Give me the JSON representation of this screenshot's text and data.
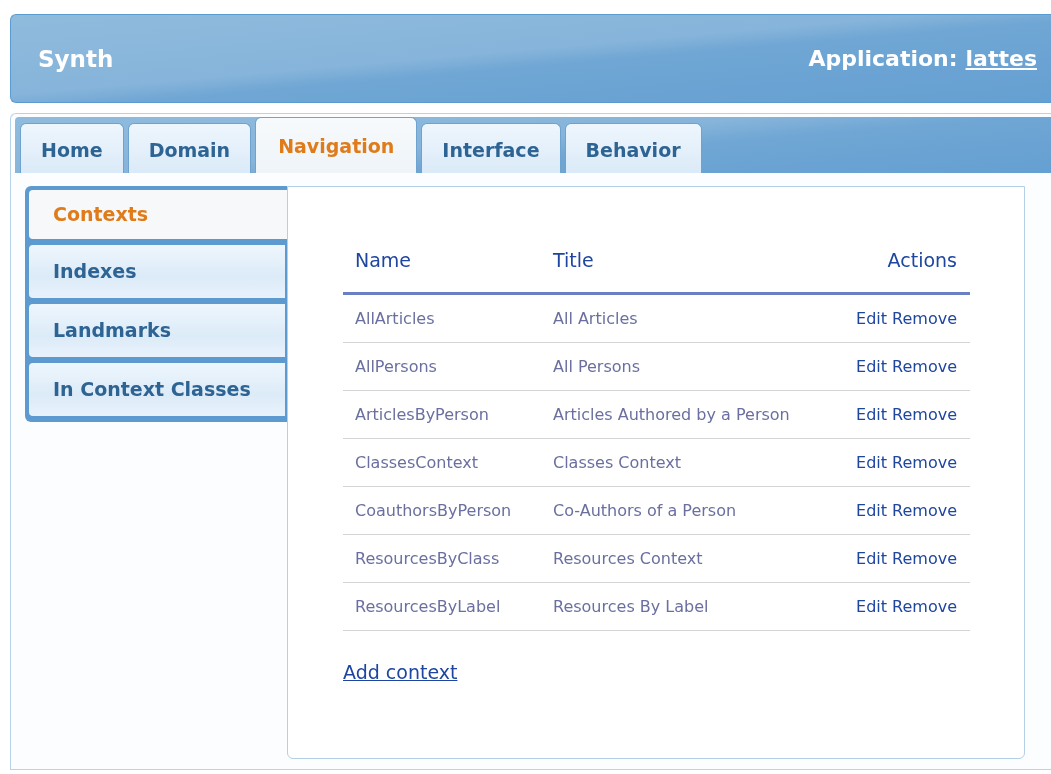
{
  "header": {
    "title": "Synth",
    "application_label": "Application:",
    "application_link": "lattes"
  },
  "tabs": [
    {
      "label": "Home",
      "selected": false
    },
    {
      "label": "Domain",
      "selected": false
    },
    {
      "label": "Navigation",
      "selected": true
    },
    {
      "label": "Interface",
      "selected": false
    },
    {
      "label": "Behavior",
      "selected": false
    }
  ],
  "sidebar": {
    "items": [
      {
        "label": "Contexts",
        "selected": true
      },
      {
        "label": "Indexes",
        "selected": false
      },
      {
        "label": "Landmarks",
        "selected": false
      },
      {
        "label": "In Context Classes",
        "selected": false
      }
    ]
  },
  "table": {
    "columns": [
      "Name",
      "Title",
      "Actions"
    ],
    "rows": [
      {
        "name": "AllArticles",
        "title": "All Articles",
        "actions": [
          "Edit",
          "Remove"
        ]
      },
      {
        "name": "AllPersons",
        "title": "All Persons",
        "actions": [
          "Edit",
          "Remove"
        ]
      },
      {
        "name": "ArticlesByPerson",
        "title": "Articles Authored by a Person",
        "actions": [
          "Edit",
          "Remove"
        ]
      },
      {
        "name": "ClassesContext",
        "title": "Classes Context",
        "actions": [
          "Edit",
          "Remove"
        ]
      },
      {
        "name": "CoauthorsByPerson",
        "title": "Co-Authors of a Person",
        "actions": [
          "Edit",
          "Remove"
        ]
      },
      {
        "name": "ResourcesByClass",
        "title": "Resources Context",
        "actions": [
          "Edit",
          "Remove"
        ]
      },
      {
        "name": "ResourcesByLabel",
        "title": "Resources By Label",
        "actions": [
          "Edit",
          "Remove"
        ]
      }
    ]
  },
  "add_link": "Add context"
}
